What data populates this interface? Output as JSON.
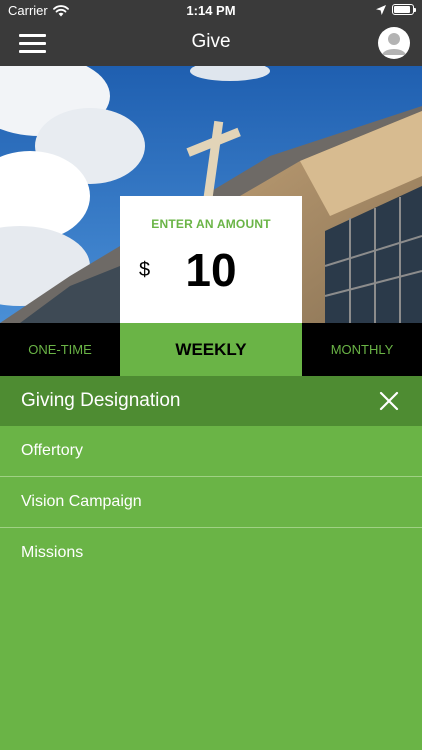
{
  "status_bar": {
    "carrier": "Carrier",
    "time": "1:14 PM"
  },
  "nav": {
    "title": "Give"
  },
  "amount": {
    "label": "ENTER AN AMOUNT",
    "currency": "$",
    "value": "10"
  },
  "frequency": {
    "tabs": [
      {
        "label": "ONE-TIME"
      },
      {
        "label": "WEEKLY"
      },
      {
        "label": "MONTHLY"
      }
    ]
  },
  "designation": {
    "title": "Giving Designation",
    "options": [
      {
        "label": "Offertory"
      },
      {
        "label": "Vision Campaign"
      },
      {
        "label": "Missions"
      }
    ]
  },
  "colors": {
    "accent_green": "#6ab446",
    "header_green": "#4e8c32",
    "bar_dark": "#3a3a3a"
  }
}
